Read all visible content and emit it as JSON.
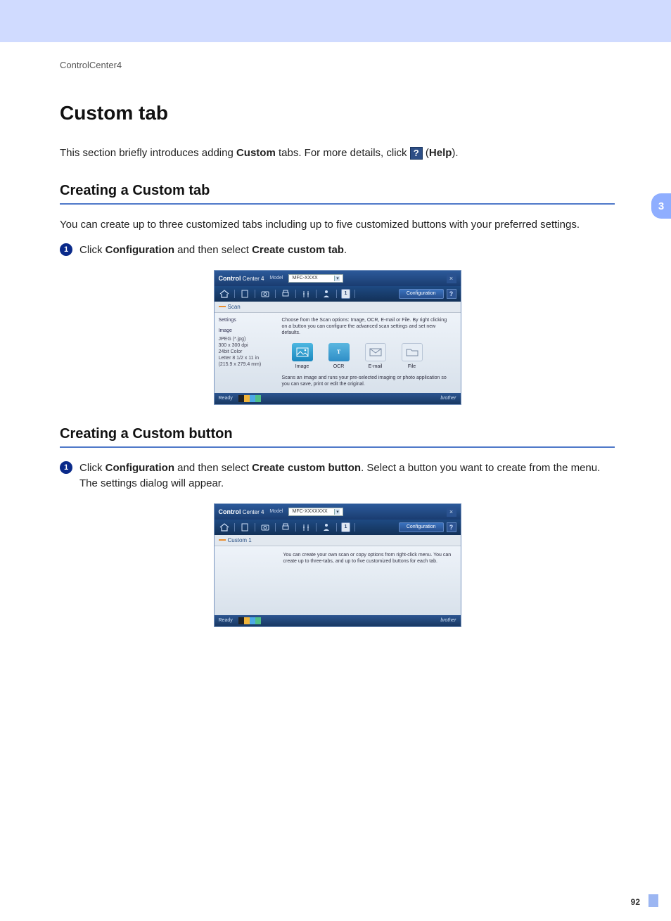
{
  "breadcrumb": "ControlCenter4",
  "chapter": "3",
  "pageNumber": "92",
  "title": "Custom tab",
  "intro": {
    "pre": "This section briefly introduces adding ",
    "bold1": "Custom",
    "mid": " tabs. For more details, click ",
    "helpGlyph": "?",
    "post_open": " (",
    "helpWord": "Help",
    "post_close": ")."
  },
  "section1": {
    "heading": "Creating a Custom tab",
    "para": "You can create up to three customized tabs including up to five customized buttons with your preferred settings.",
    "step1": {
      "num": "1",
      "pre": "Click ",
      "b1": "Configuration",
      "mid": " and then select ",
      "b2": "Create custom tab",
      "post": "."
    }
  },
  "shot1": {
    "appTitle": "Control",
    "appTitleLight": " Center 4",
    "modelLabel": "Model",
    "modelValue": "MFC-XXXX",
    "configBtn": "Configuration",
    "help": "?",
    "close": "×",
    "tabActive": "1",
    "chipLabel": "Scan",
    "sideHeading": "Settings",
    "sideHeading2": "Image",
    "sideDetails": "JPEG (*.jpg)\n300 x 300 dpi\n24bit Color\nLetter 8 1/2 x 11 in\n(215.9 x 279.4 mm)",
    "desc": "Choose from the Scan options: Image, OCR, E-mail or File. By right clicking on a button you can configure the advanced scan settings and set new defaults.",
    "btns": {
      "image": "Image",
      "ocr": "OCR",
      "email": "E-mail",
      "file": "File"
    },
    "ocrGlyph": "T",
    "footer": "Scans an image and runs your pre-selected imaging or photo application so you can save, print or edit the original.",
    "status": "Ready",
    "brand": "brother"
  },
  "section2": {
    "heading": "Creating a Custom button",
    "step1": {
      "num": "1",
      "pre": "Click ",
      "b1": "Configuration",
      "mid": " and then select ",
      "b2": "Create custom button",
      "post": ". Select a button you want to create from the menu. The settings dialog will appear."
    }
  },
  "shot2": {
    "appTitle": "Control",
    "appTitleLight": " Center 4",
    "modelLabel": "Model",
    "modelValue": "MFC-XXXXXXX",
    "configBtn": "Configuration",
    "help": "?",
    "close": "×",
    "tabActive": "1",
    "chipLabel": "Custom 1",
    "desc": "You can create your own scan or copy options from right-click menu. You can create up to three-tabs, and up to five customized buttons for each tab.",
    "status": "Ready",
    "brand": "brother"
  }
}
